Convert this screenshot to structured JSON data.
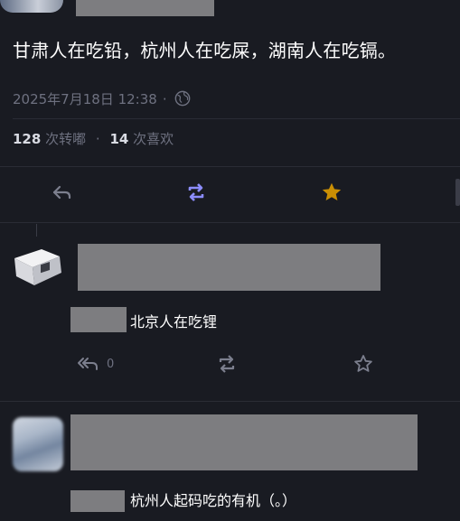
{
  "post": {
    "text": "甘肃人在吃铅，杭州人在吃屎，湖南人在吃镉。",
    "timestamp": "2025年7月18日 12:38",
    "visibility_icon": "globe-icon",
    "reposts_count": "128",
    "reposts_label": "次转嘟",
    "likes_count": "14",
    "likes_label": "次喜欢"
  },
  "actions": {
    "reply_icon": "reply-icon",
    "boost_icon": "boost-icon",
    "favourite_icon": "star-icon",
    "boost_color": "#8c8dff",
    "favourite_color": "#ca8f04"
  },
  "replies": [
    {
      "text": "北京人在吃锂",
      "reply_count": "0"
    },
    {
      "text": "杭州人起码吃的有机（。）"
    }
  ]
}
